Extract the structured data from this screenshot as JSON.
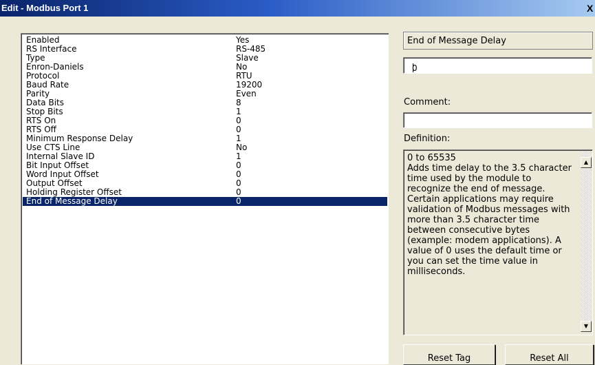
{
  "window": {
    "title": "Edit - Modbus Port 1",
    "close_glyph": "X"
  },
  "parameters": [
    {
      "name": "Enabled",
      "value": "Yes"
    },
    {
      "name": "RS Interface",
      "value": "RS-485"
    },
    {
      "name": "Type",
      "value": "Slave"
    },
    {
      "name": "Enron-Daniels",
      "value": "No"
    },
    {
      "name": "Protocol",
      "value": "RTU"
    },
    {
      "name": "Baud Rate",
      "value": "19200"
    },
    {
      "name": "Parity",
      "value": "Even"
    },
    {
      "name": "Data Bits",
      "value": "8"
    },
    {
      "name": "Stop Bits",
      "value": "1"
    },
    {
      "name": "RTS On",
      "value": "0"
    },
    {
      "name": "RTS Off",
      "value": "0"
    },
    {
      "name": "Minimum Response Delay",
      "value": "1"
    },
    {
      "name": "Use CTS Line",
      "value": "No"
    },
    {
      "name": "Internal Slave ID",
      "value": "1"
    },
    {
      "name": "Bit Input Offset",
      "value": "0"
    },
    {
      "name": "Word Input Offset",
      "value": "0"
    },
    {
      "name": "Output Offset",
      "value": "0"
    },
    {
      "name": "Holding Register Offset",
      "value": "0"
    },
    {
      "name": "End of Message Delay",
      "value": "0",
      "selected": true
    }
  ],
  "editor": {
    "parameter_name": "End of Message Delay",
    "value": "0",
    "comment_label": "Comment:",
    "comment_value": "",
    "definition_label": "Definition:",
    "definition_text": "0 to 65535\nAdds time delay to the 3.5 character time used by the module to recognize the end of message. Certain applications may require validation of Modbus messages with more than 3.5 character time between consecutive bytes (example: modem applications).   A value of 0 uses the default  time or you can set the time value in milliseconds."
  },
  "buttons": {
    "reset_tag": "Reset Tag",
    "reset_all": "Reset All"
  },
  "colors": {
    "selection": "#0a246a",
    "dialog_bg": "#ece9d8"
  }
}
